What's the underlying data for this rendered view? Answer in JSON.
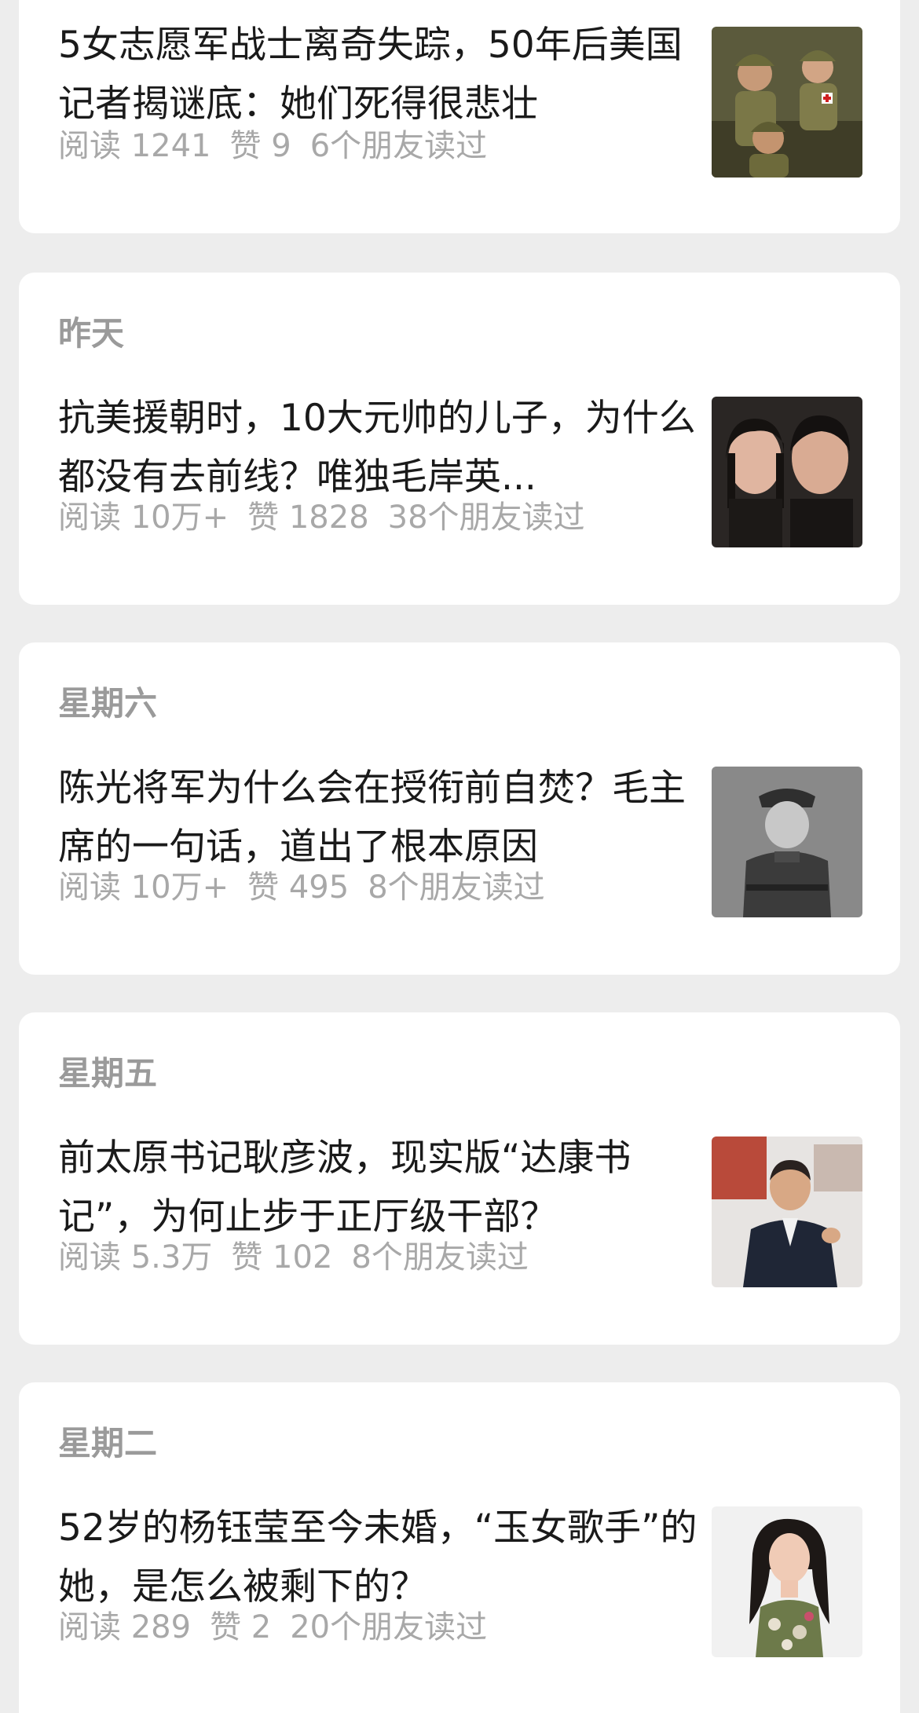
{
  "articles": [
    {
      "date": "",
      "title": "5女志愿军战士离奇失踪，50年后美国记者揭谜底：她们死得很悲壮",
      "reads": "阅读 1241",
      "likes": "赞 9",
      "friends": "6个朋友读过",
      "thumbnail_icon": "soldiers-photo-icon"
    },
    {
      "date": "昨天",
      "title": "抗美援朝时，10大元帅的儿子，为什么都没有去前线？唯独毛岸英...",
      "reads": "阅读 10万+",
      "likes": "赞 1828",
      "friends": "38个朋友读过",
      "thumbnail_icon": "couple-portrait-icon"
    },
    {
      "date": "星期六",
      "title": "陈光将军为什么会在授衔前自焚？毛主席的一句话，道出了根本原因",
      "reads": "阅读 10万+",
      "likes": "赞 495",
      "friends": "8个朋友读过",
      "thumbnail_icon": "general-photo-icon"
    },
    {
      "date": "星期五",
      "title": "前太原书记耿彦波，现实版“达康书记”，为何止步于正厅级干部？",
      "reads": "阅读 5.3万",
      "likes": "赞 102",
      "friends": "8个朋友读过",
      "thumbnail_icon": "official-photo-icon"
    },
    {
      "date": "星期二",
      "title": "52岁的杨钰莹至今未婚，“玉女歌手”的她，是怎么被剩下的？",
      "reads": "阅读 289",
      "likes": "赞 2",
      "friends": "20个朋友读过",
      "thumbnail_icon": "singer-photo-icon"
    }
  ]
}
